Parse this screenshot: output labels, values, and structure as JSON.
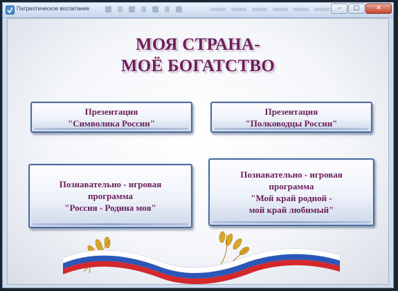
{
  "window": {
    "title": "Патриотическое воспитание",
    "controls": {
      "minimize": "–",
      "maximize": "□",
      "close": "✕"
    },
    "icon": "app-icon"
  },
  "page": {
    "heading": [
      "МОЯ СТРАНА-",
      "МОЁ БОГАТСТВО"
    ]
  },
  "tiles": [
    {
      "lines": [
        "Презентация",
        "\"Символика России\""
      ]
    },
    {
      "lines": [
        "Презентация",
        "\"Полководцы России\""
      ]
    },
    {
      "lines": [
        "Познавательно - игровая",
        "программа",
        "\"Россия - Родина моя\""
      ]
    },
    {
      "lines": [
        "Познавательно - игровая",
        "программа",
        "\"Мой край родной -",
        "мой край любимый\""
      ]
    }
  ],
  "decoration": {
    "flag_colors": [
      "#ffffff",
      "#2b57b8",
      "#d3282c"
    ],
    "wheat_color": "#d9a62b",
    "icon": "russian-flag-ribbon-icon"
  }
}
